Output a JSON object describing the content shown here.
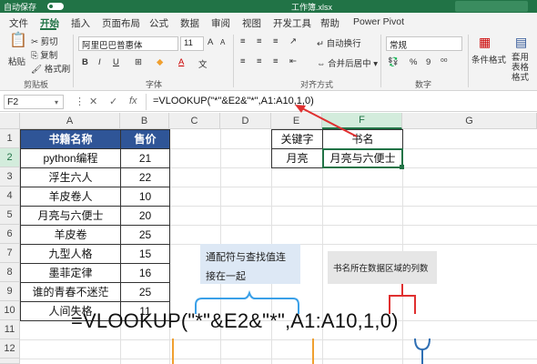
{
  "titlebar": {
    "autosave": "自动保存",
    "filename": "工作簿.xlsx"
  },
  "menu": {
    "items": [
      "文件",
      "开始",
      "插入",
      "页面布局",
      "公式",
      "数据",
      "审阅",
      "视图",
      "开发工具",
      "帮助",
      "Power Pivot"
    ],
    "active": "开始"
  },
  "ribbon": {
    "paste": "粘贴",
    "cut": "剪切",
    "copy": "复制",
    "format_painter": "格式刷",
    "clipboard_group": "剪贴板",
    "font_name": "阿里巴巴普惠体",
    "font_size": "11",
    "font_group": "字体",
    "wrap_text": "自动换行",
    "merge_center": "合并后居中",
    "align_group": "对齐方式",
    "number_format": "常规",
    "number_group": "数字",
    "conditional_format": "条件格式",
    "table_format": "套用表格格式"
  },
  "formula_bar": {
    "name_box": "F2",
    "formula": "=VLOOKUP(\"*\"&E2&\"*\",A1:A10,1,0)"
  },
  "columns": [
    "A",
    "B",
    "C",
    "D",
    "E",
    "F",
    "G"
  ],
  "rows": [
    "1",
    "2",
    "3",
    "4",
    "5",
    "6",
    "7",
    "8",
    "9",
    "10",
    "11",
    "12",
    "13"
  ],
  "table": {
    "headers": [
      "书籍名称",
      "售价"
    ],
    "rows": [
      [
        "python编程",
        "21"
      ],
      [
        "浮生六人",
        "22"
      ],
      [
        "羊皮卷人",
        "10"
      ],
      [
        "月亮与六便士",
        "20"
      ],
      [
        "羊皮卷",
        "25"
      ],
      [
        "九型人格",
        "15"
      ],
      [
        "墨菲定律",
        "16"
      ],
      [
        "谁的青春不迷茫",
        "25"
      ],
      [
        "人间失格",
        "11"
      ]
    ]
  },
  "lookup": {
    "key_header": "关键字",
    "key_value": "月亮",
    "result_header": "书名",
    "result_value": "月亮与六便士"
  },
  "annotations": {
    "wildcard_note_line1": "通配符与查找值连",
    "wildcard_note_line2": "接在一起",
    "range_note": "书名所在数据区域的列数",
    "big_formula": "=VLOOKUP(\"*\"&E2&\"*\",A1:A10,1,0)"
  },
  "colors": {
    "excel_green": "#217346",
    "table_header": "#2f5597",
    "arrow_red": "#e03030",
    "brace_blue": "#2f6fb3",
    "brace_orange": "#f0a030"
  }
}
